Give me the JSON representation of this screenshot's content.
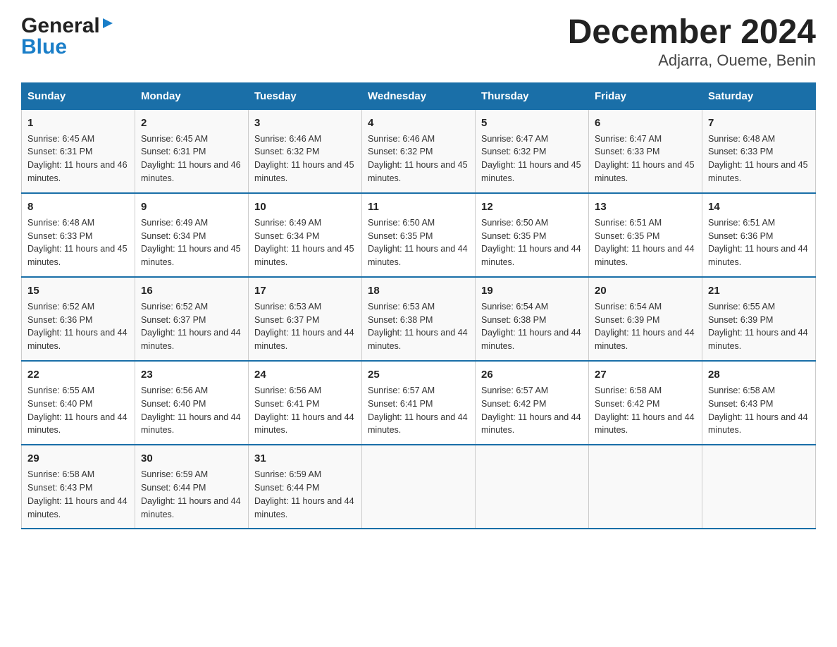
{
  "header": {
    "title": "December 2024",
    "subtitle": "Adjarra, Oueme, Benin",
    "logo_general": "General",
    "logo_blue": "Blue"
  },
  "columns": [
    "Sunday",
    "Monday",
    "Tuesday",
    "Wednesday",
    "Thursday",
    "Friday",
    "Saturday"
  ],
  "weeks": [
    [
      {
        "day": "1",
        "sunrise": "6:45 AM",
        "sunset": "6:31 PM",
        "daylight": "11 hours and 46 minutes."
      },
      {
        "day": "2",
        "sunrise": "6:45 AM",
        "sunset": "6:31 PM",
        "daylight": "11 hours and 46 minutes."
      },
      {
        "day": "3",
        "sunrise": "6:46 AM",
        "sunset": "6:32 PM",
        "daylight": "11 hours and 45 minutes."
      },
      {
        "day": "4",
        "sunrise": "6:46 AM",
        "sunset": "6:32 PM",
        "daylight": "11 hours and 45 minutes."
      },
      {
        "day": "5",
        "sunrise": "6:47 AM",
        "sunset": "6:32 PM",
        "daylight": "11 hours and 45 minutes."
      },
      {
        "day": "6",
        "sunrise": "6:47 AM",
        "sunset": "6:33 PM",
        "daylight": "11 hours and 45 minutes."
      },
      {
        "day": "7",
        "sunrise": "6:48 AM",
        "sunset": "6:33 PM",
        "daylight": "11 hours and 45 minutes."
      }
    ],
    [
      {
        "day": "8",
        "sunrise": "6:48 AM",
        "sunset": "6:33 PM",
        "daylight": "11 hours and 45 minutes."
      },
      {
        "day": "9",
        "sunrise": "6:49 AM",
        "sunset": "6:34 PM",
        "daylight": "11 hours and 45 minutes."
      },
      {
        "day": "10",
        "sunrise": "6:49 AM",
        "sunset": "6:34 PM",
        "daylight": "11 hours and 45 minutes."
      },
      {
        "day": "11",
        "sunrise": "6:50 AM",
        "sunset": "6:35 PM",
        "daylight": "11 hours and 44 minutes."
      },
      {
        "day": "12",
        "sunrise": "6:50 AM",
        "sunset": "6:35 PM",
        "daylight": "11 hours and 44 minutes."
      },
      {
        "day": "13",
        "sunrise": "6:51 AM",
        "sunset": "6:35 PM",
        "daylight": "11 hours and 44 minutes."
      },
      {
        "day": "14",
        "sunrise": "6:51 AM",
        "sunset": "6:36 PM",
        "daylight": "11 hours and 44 minutes."
      }
    ],
    [
      {
        "day": "15",
        "sunrise": "6:52 AM",
        "sunset": "6:36 PM",
        "daylight": "11 hours and 44 minutes."
      },
      {
        "day": "16",
        "sunrise": "6:52 AM",
        "sunset": "6:37 PM",
        "daylight": "11 hours and 44 minutes."
      },
      {
        "day": "17",
        "sunrise": "6:53 AM",
        "sunset": "6:37 PM",
        "daylight": "11 hours and 44 minutes."
      },
      {
        "day": "18",
        "sunrise": "6:53 AM",
        "sunset": "6:38 PM",
        "daylight": "11 hours and 44 minutes."
      },
      {
        "day": "19",
        "sunrise": "6:54 AM",
        "sunset": "6:38 PM",
        "daylight": "11 hours and 44 minutes."
      },
      {
        "day": "20",
        "sunrise": "6:54 AM",
        "sunset": "6:39 PM",
        "daylight": "11 hours and 44 minutes."
      },
      {
        "day": "21",
        "sunrise": "6:55 AM",
        "sunset": "6:39 PM",
        "daylight": "11 hours and 44 minutes."
      }
    ],
    [
      {
        "day": "22",
        "sunrise": "6:55 AM",
        "sunset": "6:40 PM",
        "daylight": "11 hours and 44 minutes."
      },
      {
        "day": "23",
        "sunrise": "6:56 AM",
        "sunset": "6:40 PM",
        "daylight": "11 hours and 44 minutes."
      },
      {
        "day": "24",
        "sunrise": "6:56 AM",
        "sunset": "6:41 PM",
        "daylight": "11 hours and 44 minutes."
      },
      {
        "day": "25",
        "sunrise": "6:57 AM",
        "sunset": "6:41 PM",
        "daylight": "11 hours and 44 minutes."
      },
      {
        "day": "26",
        "sunrise": "6:57 AM",
        "sunset": "6:42 PM",
        "daylight": "11 hours and 44 minutes."
      },
      {
        "day": "27",
        "sunrise": "6:58 AM",
        "sunset": "6:42 PM",
        "daylight": "11 hours and 44 minutes."
      },
      {
        "day": "28",
        "sunrise": "6:58 AM",
        "sunset": "6:43 PM",
        "daylight": "11 hours and 44 minutes."
      }
    ],
    [
      {
        "day": "29",
        "sunrise": "6:58 AM",
        "sunset": "6:43 PM",
        "daylight": "11 hours and 44 minutes."
      },
      {
        "day": "30",
        "sunrise": "6:59 AM",
        "sunset": "6:44 PM",
        "daylight": "11 hours and 44 minutes."
      },
      {
        "day": "31",
        "sunrise": "6:59 AM",
        "sunset": "6:44 PM",
        "daylight": "11 hours and 44 minutes."
      },
      null,
      null,
      null,
      null
    ]
  ],
  "colors": {
    "header_bg": "#1a6fa8",
    "accent": "#1a6fa8"
  }
}
